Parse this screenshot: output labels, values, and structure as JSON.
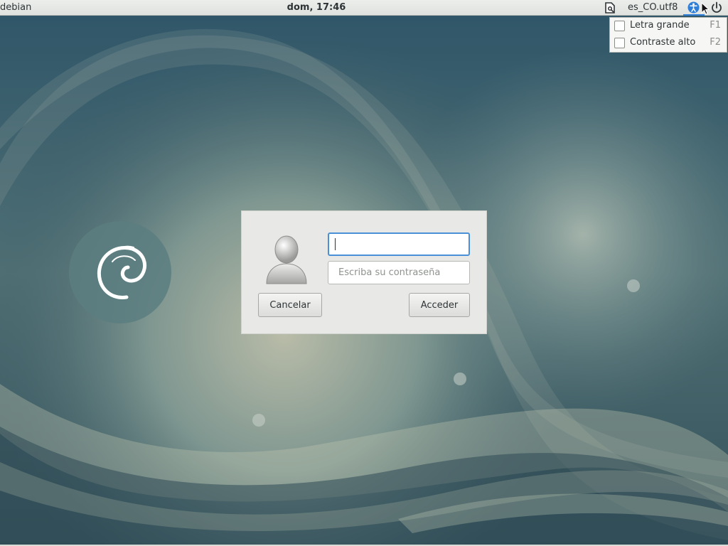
{
  "top_panel": {
    "hostname": "debian",
    "clock": "dom, 17:46",
    "locale": "es_CO.utf8",
    "icons": {
      "session": "session-document-icon",
      "accessibility": "accessibility-icon",
      "power": "power-icon",
      "cursor": "mouse-pointer-icon"
    }
  },
  "accessibility_menu": {
    "items": [
      {
        "label": "Letra grande",
        "shortcut": "F1",
        "checked": false
      },
      {
        "label": "Contraste alto",
        "shortcut": "F2",
        "checked": false
      }
    ]
  },
  "login": {
    "username_value": "",
    "password_placeholder": "Escriba su contraseña",
    "cancel_label": "Cancelar",
    "login_label": "Acceder",
    "avatar_icon": "user-avatar-icon"
  },
  "desktop": {
    "logo_icon": "debian-swirl-icon"
  },
  "colors": {
    "accent": "#4a90d9",
    "panel": "#e4e6e3",
    "dialog": "#e8e8e7",
    "wallpaper": "#3f5f68"
  }
}
